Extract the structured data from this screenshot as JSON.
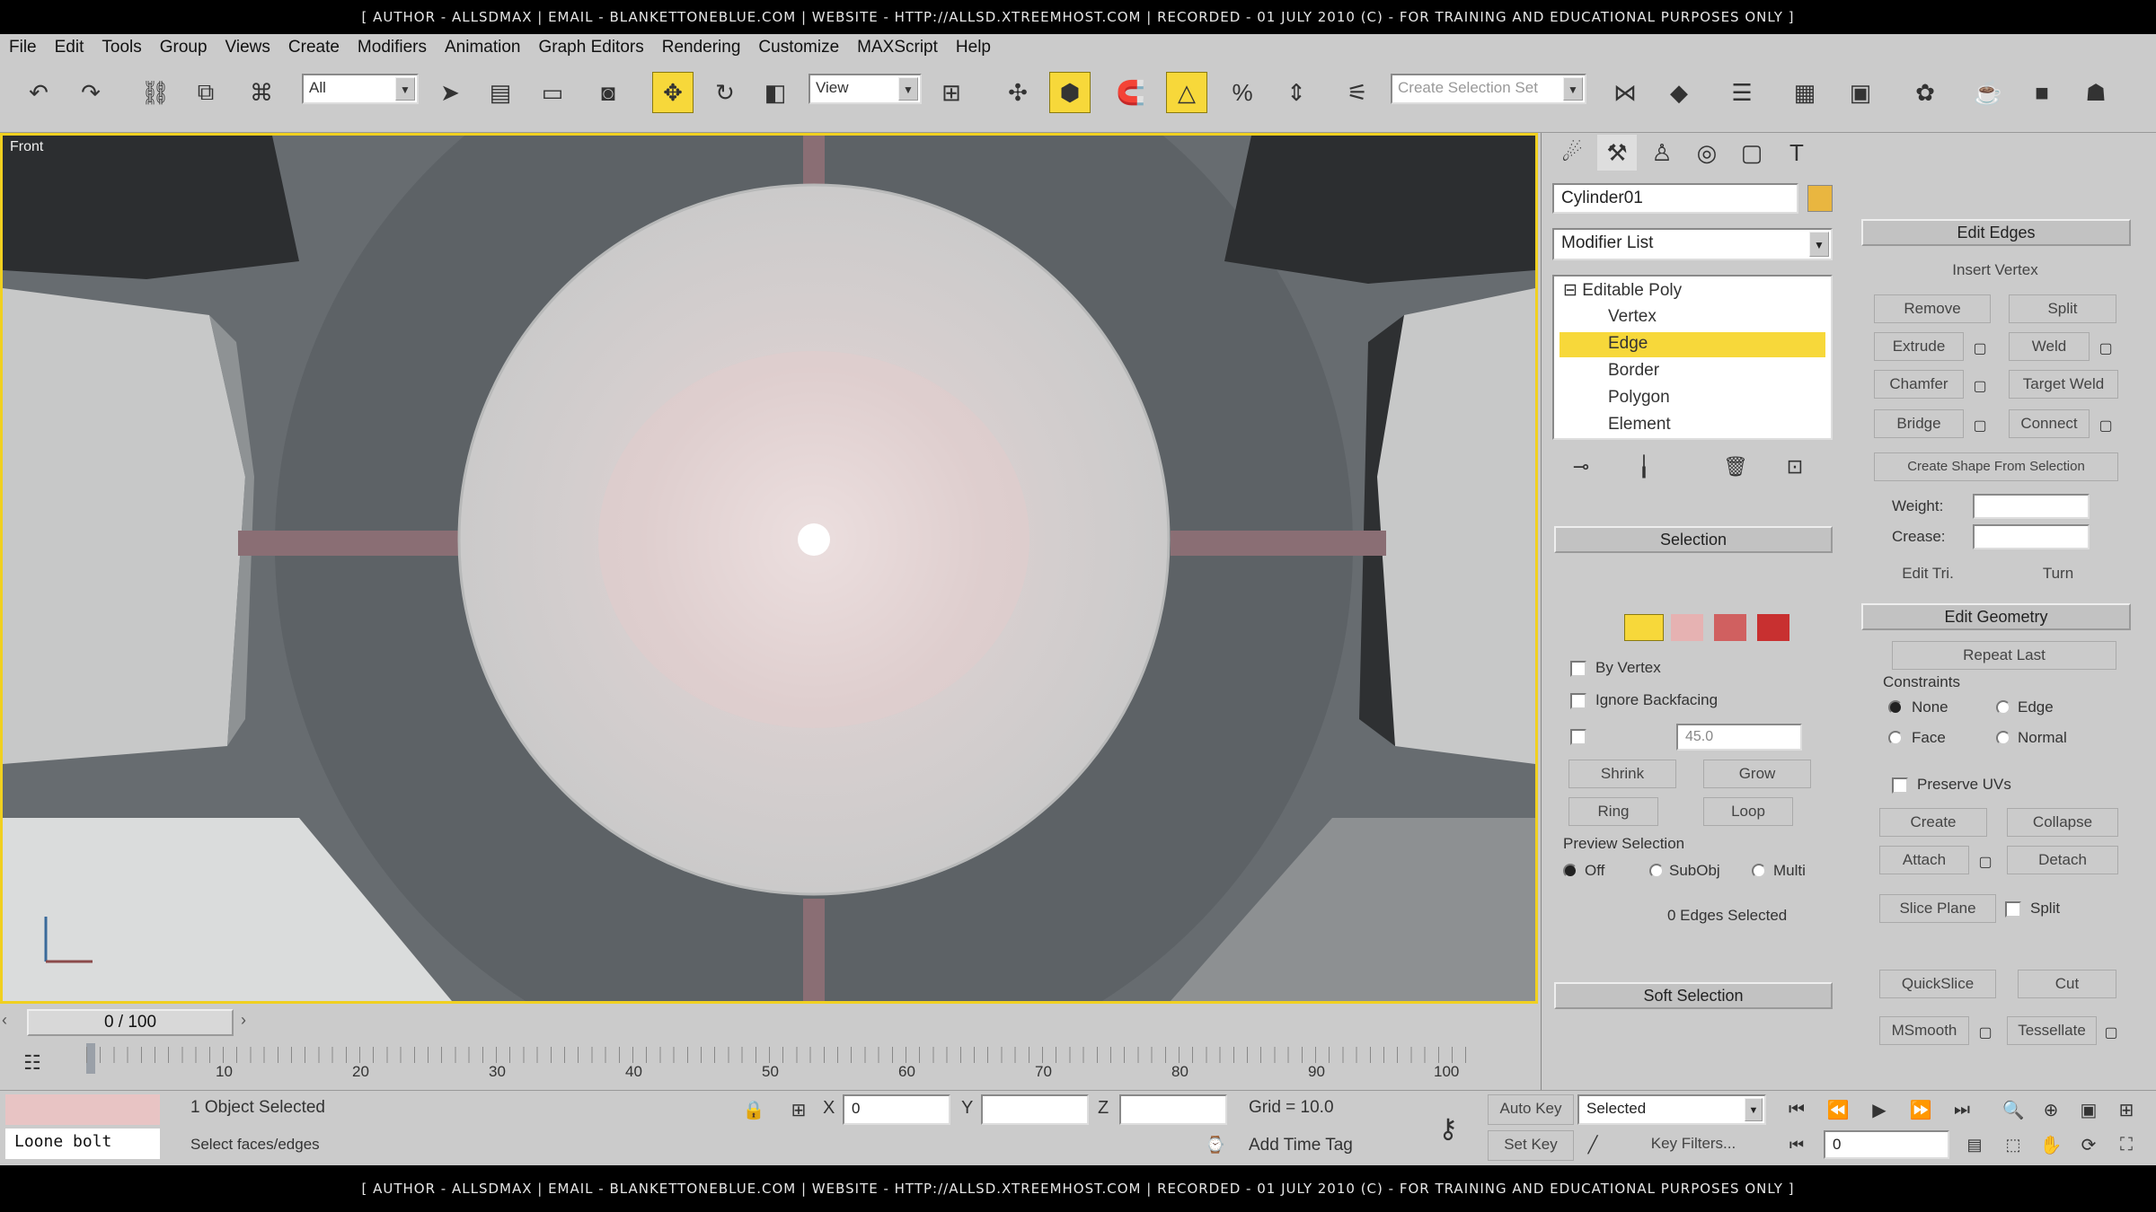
{
  "banner": {
    "top": "[ AUTHOR - ALLSDMAX | EMAIL - BLANKETTONEBLUE.COM | WEBSITE - HTTP://ALLSD.XTREEMHOST.COM | RECORDED - 01 JULY 2010 (C) - FOR TRAINING AND EDUCATIONAL PURPOSES ONLY ]",
    "bottom": "[ AUTHOR - ALLSDMAX | EMAIL - BLANKETTONEBLUE.COM | WEBSITE - HTTP://ALLSD.XTREEMHOST.COM | RECORDED - 01 JULY 2010 (C) - FOR TRAINING AND EDUCATIONAL PURPOSES ONLY ]"
  },
  "menu": [
    "File",
    "Edit",
    "Tools",
    "Group",
    "Views",
    "Create",
    "Modifiers",
    "Animation",
    "Graph Editors",
    "Rendering",
    "Customize",
    "MAXScript",
    "Help"
  ],
  "toolbar": {
    "filter_value": "All",
    "refcoord_value": "View",
    "named_selection_placeholder": "Create Selection Set"
  },
  "viewport": {
    "label": "Front"
  },
  "command_panel": {
    "object_name": "Cylinder01",
    "object_color": "#e9b640",
    "modifier_list": "Modifier List",
    "stack": {
      "root": "Editable Poly",
      "items": [
        "Vertex",
        "Edge",
        "Border",
        "Polygon",
        "Element"
      ],
      "selected": "Edge"
    },
    "selection_rollout": {
      "title": "Selection",
      "by_vertex": "By Vertex",
      "ignore_backfacing": "Ignore Backfacing",
      "angle_value": "45.0",
      "shrink": "Shrink",
      "grow": "Grow",
      "ring": "Ring",
      "loop": "Loop",
      "preview_selection": "Preview Selection",
      "preview_off": "Off",
      "preview_subobj": "SubObj",
      "preview_multi": "Multi",
      "status": "0 Edges Selected"
    },
    "soft_selection": "Soft Selection",
    "edit_edges": {
      "title": "Edit Edges",
      "insert_vertex": "Insert Vertex",
      "remove": "Remove",
      "split": "Split",
      "extrude": "Extrude",
      "weld": "Weld",
      "chamfer": "Chamfer",
      "target_weld": "Target Weld",
      "bridge": "Bridge",
      "connect": "Connect",
      "create_shape": "Create Shape From Selection",
      "weight": "Weight:",
      "crease": "Crease:",
      "edit_tri": "Edit Tri.",
      "turn": "Turn"
    },
    "edit_geometry": {
      "title": "Edit Geometry",
      "repeat_last": "Repeat Last",
      "constraints": "Constraints",
      "none": "None",
      "edge": "Edge",
      "face": "Face",
      "normal": "Normal",
      "preserve_uvs": "Preserve UVs",
      "create": "Create",
      "collapse": "Collapse",
      "attach": "Attach",
      "detach": "Detach",
      "slice_plane": "Slice Plane",
      "split": "Split",
      "quickslice": "QuickSlice",
      "cut": "Cut",
      "msmooth": "MSmooth",
      "tessellate": "Tessellate"
    }
  },
  "timeline": {
    "frame": "0 / 100",
    "ticks": [
      "10",
      "20",
      "30",
      "40",
      "50",
      "60",
      "70",
      "80",
      "90",
      "100"
    ]
  },
  "status": {
    "maxscript_text": "Loone bolt",
    "selected": "1 Object Selected",
    "prompt": "Select faces/edges",
    "x": "0",
    "y": "",
    "z": "",
    "grid": "Grid = 10.0",
    "add_time_tag": "Add Time Tag",
    "auto_key": "Auto Key",
    "set_key": "Set Key",
    "selected_dropdown": "Selected",
    "key_filters": "Key Filters...",
    "frame_field": "0"
  }
}
